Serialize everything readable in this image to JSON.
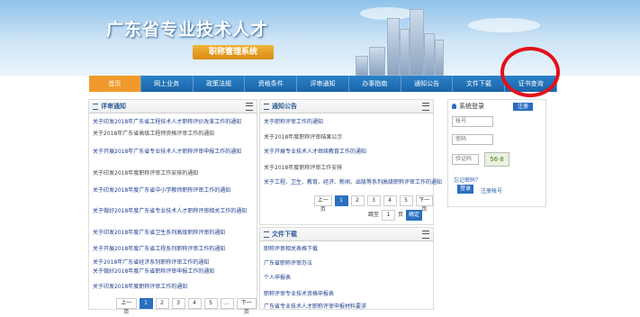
{
  "header": {
    "title": "广东省专业技术人才",
    "subtitle": "职称管理系统"
  },
  "nav": {
    "items": [
      "首页",
      "网上业务",
      "政策法规",
      "资格条件",
      "评审通知",
      "办事指南",
      "通知公告",
      "文件下载",
      "证书查询"
    ]
  },
  "left_panel": {
    "title": "评审通知",
    "items": [
      "关于印发2018年广东省工程技术人才职称评价改革工作的通知",
      "关于2018年广东省高级工程师资格评审工作的通知",
      "关于开展2018年广东省专业技术人才职称评审申报工作的通知",
      "关于印发2018年度职称评审工作安排的通知",
      "关于印发2018年度广东省中小学教师职称评审工作的通知",
      "关于做好2018年度广东省专业技术人才职称评审相关工作的通知",
      "关于印发2018年度广东省卫生系列高级职称评审的通知",
      "关于开展2018年度广东省工程系列职称评审工作的通知",
      "关于2018年广东省经济系列职称评审工作的通知",
      "关于做好2018年度广东省职称评审申报工作的通知",
      "关于印发2018年度职称评审工作的通知"
    ],
    "pager": [
      "上一页",
      "1",
      "2",
      "3",
      "4",
      "5",
      "...",
      "下一页"
    ]
  },
  "mid_panel": {
    "title": "通知公告",
    "items": [
      "关于职称评审工作的通知",
      "关于2018年度职称评审结果公示",
      "关于开展专业技术人才继续教育工作的通知",
      "关于2018年度职称评审工作安排",
      "关于工程、卫生、教育、经济、新闻、出版等系列高级职称评审工作的通知"
    ],
    "pager": [
      "上一页",
      "1",
      "2",
      "3",
      "4",
      "5",
      "下一页"
    ],
    "goto": [
      "跳至",
      "1",
      "页",
      "确定"
    ]
  },
  "files_panel": {
    "title": "文件下载",
    "items": [
      "职称评审相关表格下载",
      "广东省职称评审办法",
      "个人申报表",
      "职称评审专业技术资格申报表",
      "广东省专业技术人才职称评审申报材料要求"
    ]
  },
  "login": {
    "title": "系统登录",
    "register_label": "注册",
    "user_placeholder": "帐号",
    "pass_placeholder": "密码",
    "captcha_placeholder": "验证码",
    "captcha_text": "56·8",
    "login_button": "登录",
    "links": [
      "忘记密码？",
      "注册帐号"
    ]
  },
  "annotation": {
    "color": "#e3101a"
  }
}
